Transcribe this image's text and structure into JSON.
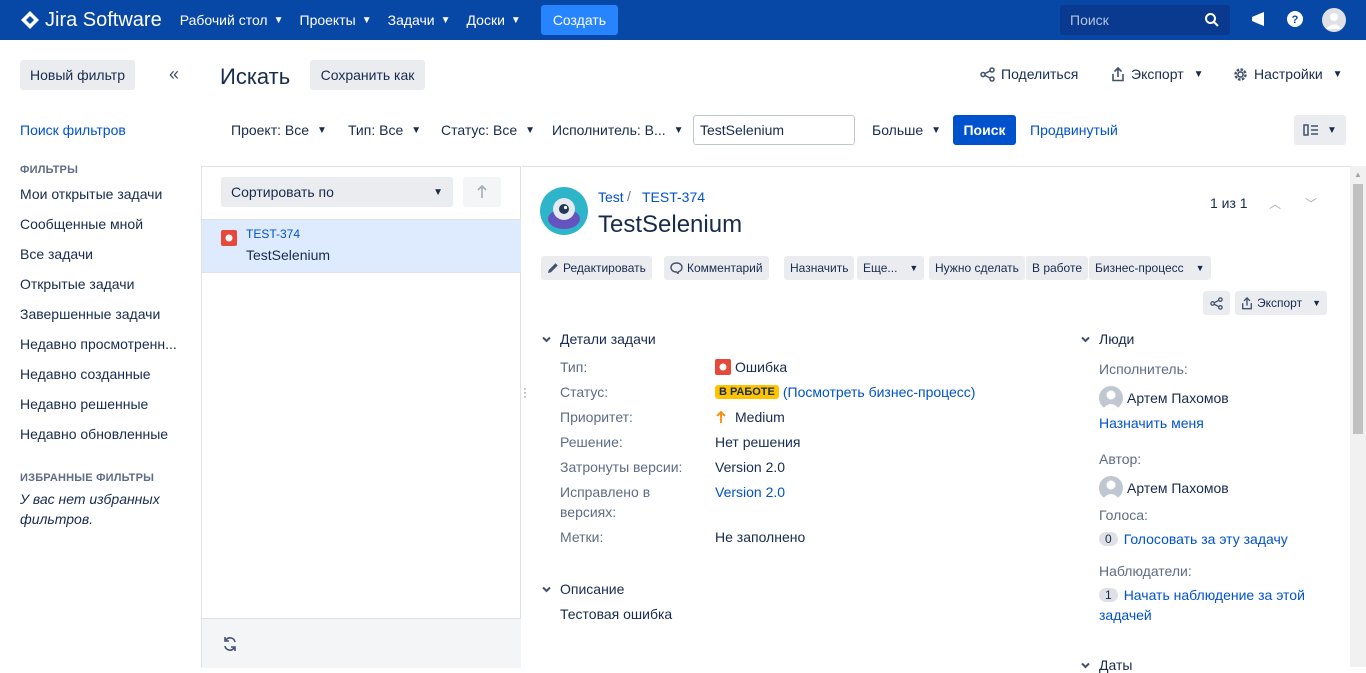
{
  "topnav": {
    "brand": "Jira Software",
    "menu": [
      {
        "label": "Рабочий стол"
      },
      {
        "label": "Проекты"
      },
      {
        "label": "Задачи"
      },
      {
        "label": "Доски"
      }
    ],
    "create_label": "Создать",
    "search_placeholder": "Поиск",
    "colors": {
      "bar": "#0747a6",
      "create": "#2684ff"
    }
  },
  "sidebar": {
    "new_filter_label": "Новый фильтр",
    "find_filters_label": "Поиск фильтров",
    "filters_heading": "ФИЛЬТРЫ",
    "filters": [
      "Мои открытые задачи",
      "Сообщенные мной",
      "Все задачи",
      "Открытые задачи",
      "Завершенные задачи",
      "Недавно просмотренн...",
      "Недавно созданные",
      "Недавно решенные",
      "Недавно обновленные"
    ],
    "favorites_heading": "ИЗБРАННЫЕ ФИЛЬТРЫ",
    "favorites_empty_line1": "У вас нет избранных",
    "favorites_empty_line2": "фильтров."
  },
  "header": {
    "title": "Искать",
    "save_as_label": "Сохранить как",
    "share_label": "Поделиться",
    "export_label": "Экспорт",
    "settings_label": "Настройки"
  },
  "filters": {
    "project": "Проект: Все",
    "type": "Тип: Все",
    "status": "Статус: Все",
    "assignee": "Исполнитель: В...",
    "query_value": "TestSelenium",
    "more": "Больше",
    "search_button": "Поиск",
    "advanced": "Продвинутый"
  },
  "list": {
    "sort_label": "Сортировать по",
    "items": [
      {
        "key": "TEST-374",
        "summary": "TestSelenium"
      }
    ]
  },
  "issue": {
    "project": "Test",
    "key": "TEST-374",
    "title": "TestSelenium",
    "pager": "1 из 1",
    "actions": {
      "edit": "Редактировать",
      "comment": "Комментарий",
      "assign": "Назначить",
      "more": "Еще...",
      "todo": "Нужно сделать",
      "in_progress": "В работе",
      "workflow": "Бизнес-процесс",
      "export": "Экспорт"
    },
    "details": {
      "heading": "Детали задачи",
      "type_label": "Тип:",
      "type_value": "Ошибка",
      "status_label": "Статус:",
      "status_value": "В РАБОТЕ",
      "status_link": "(Посмотреть бизнес-процесс)",
      "priority_label": "Приоритет:",
      "priority_value": "Medium",
      "resolution_label": "Решение:",
      "resolution_value": "Нет решения",
      "affects_label": "Затронуты версии:",
      "affects_value": "Version 2.0",
      "fix_label_1": "Исправлено в",
      "fix_label_2": "версиях:",
      "fix_value": "Version 2.0",
      "labels_label": "Метки:",
      "labels_value": "Не заполнено"
    },
    "description": {
      "heading": "Описание",
      "text": "Тестовая ошибка"
    },
    "people": {
      "heading": "Люди",
      "assignee_label": "Исполнитель:",
      "assignee": "Артем Пахомов",
      "assign_me": "Назначить меня",
      "reporter_label": "Автор:",
      "reporter": "Артем Пахомов",
      "votes_label": "Голоса:",
      "votes_count": "0",
      "vote_link": "Голосовать за эту задачу",
      "watchers_label": "Наблюдатели:",
      "watchers_count": "1",
      "watch_link_1": "Начать наблюдение за этой",
      "watch_link_2": "задачей"
    },
    "dates_heading": "Даты",
    "colors": {
      "status": "#ffc400",
      "bug": "#e5493a",
      "link": "#0052cc",
      "priority": "#ff8b00"
    }
  }
}
